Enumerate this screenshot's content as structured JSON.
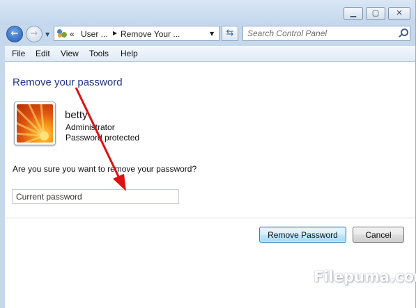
{
  "window": {
    "caption_buttons": {
      "minimize": "minimize",
      "maximize": "maximize",
      "close": "close"
    }
  },
  "navigation": {
    "back_icon": "back-arrow-icon",
    "forward_icon": "forward-arrow-icon",
    "address": {
      "overflow": "«",
      "crumbs": [
        "User ...",
        "Remove Your ..."
      ]
    },
    "search": {
      "placeholder": "Search Control Panel"
    }
  },
  "menubar": {
    "items": [
      "File",
      "Edit",
      "View",
      "Tools",
      "Help"
    ]
  },
  "main": {
    "title": "Remove your password",
    "user": {
      "name": "betty",
      "role": "Administrator",
      "status": "Password protected"
    },
    "question": "Are you sure you want to remove your password?",
    "password_field": {
      "placeholder": "Current password",
      "value": ""
    },
    "buttons": {
      "remove": "Remove Password",
      "cancel": "Cancel"
    }
  },
  "colors": {
    "title": "#1e3287",
    "annotation_arrow": "#e01010",
    "window_frame": "#c6d8ec"
  },
  "watermark": "Filepuma.com"
}
